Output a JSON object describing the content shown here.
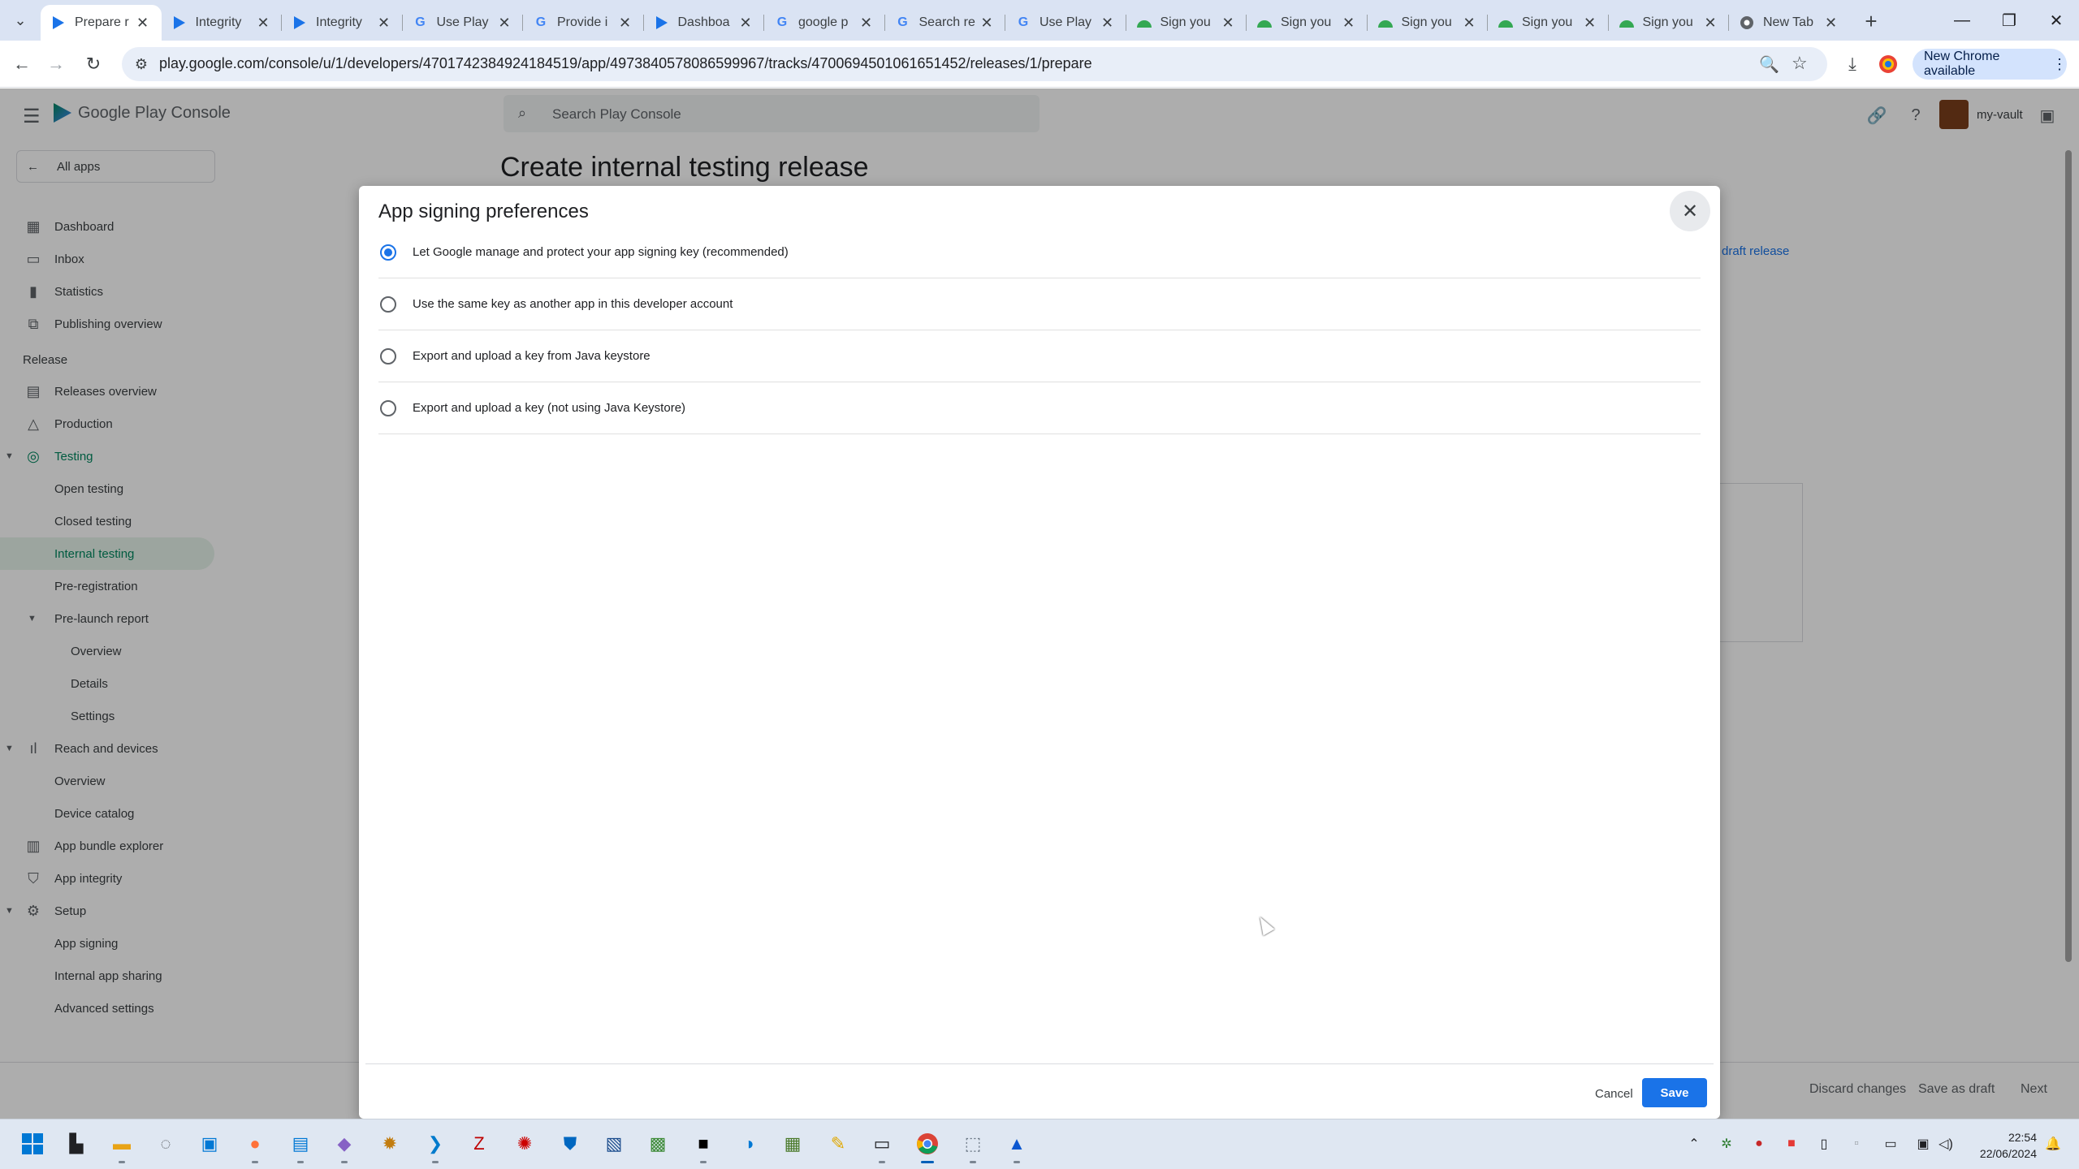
{
  "browser": {
    "tabs": [
      {
        "title": "Prepare r",
        "icon": "play-console-icon",
        "active": true
      },
      {
        "title": "Integrity",
        "icon": "play-console-icon"
      },
      {
        "title": "Integrity",
        "icon": "play-console-icon"
      },
      {
        "title": "Use Play",
        "icon": "google-icon"
      },
      {
        "title": "Provide i",
        "icon": "google-icon"
      },
      {
        "title": "Dashboa",
        "icon": "play-console-icon"
      },
      {
        "title": "google p",
        "icon": "google-icon"
      },
      {
        "title": "Search re",
        "icon": "google-icon"
      },
      {
        "title": "Use Play",
        "icon": "google-icon"
      },
      {
        "title": "Sign you",
        "icon": "android-icon"
      },
      {
        "title": "Sign you",
        "icon": "android-icon"
      },
      {
        "title": "Sign you",
        "icon": "android-icon"
      },
      {
        "title": "Sign you",
        "icon": "android-icon"
      },
      {
        "title": "Sign you",
        "icon": "android-icon"
      },
      {
        "title": "New Tab",
        "icon": "chrome-icon"
      }
    ],
    "url": "play.google.com/console/u/1/developers/4701742384924184519/app/4973840578086599967/tracks/4700694501061651452/releases/1/prepare",
    "update_label": "New Chrome available"
  },
  "console": {
    "product_name": "Google Play Console",
    "search_placeholder": "Search Play Console",
    "account_name": "my-vault",
    "all_apps_label": "All apps",
    "page_title": "Create internal testing release",
    "draft_link": "draft release",
    "footer": {
      "discard": "Discard changes",
      "save_draft": "Save as draft",
      "next": "Next"
    },
    "nav": {
      "dashboard": "Dashboard",
      "inbox": "Inbox",
      "statistics": "Statistics",
      "publishing_overview": "Publishing overview",
      "release_header": "Release",
      "releases_overview": "Releases overview",
      "production": "Production",
      "testing": "Testing",
      "open_testing": "Open testing",
      "closed_testing": "Closed testing",
      "internal_testing": "Internal testing",
      "pre_registration": "Pre-registration",
      "pre_launch_report": "Pre-launch report",
      "overview": "Overview",
      "details": "Details",
      "settings": "Settings",
      "reach_and_devices": "Reach and devices",
      "reach_overview": "Overview",
      "device_catalog": "Device catalog",
      "app_bundle_explorer": "App bundle explorer",
      "app_integrity": "App integrity",
      "setup": "Setup",
      "app_signing": "App signing",
      "internal_app_sharing": "Internal app sharing",
      "advanced_settings": "Advanced settings"
    }
  },
  "dialog": {
    "title": "App signing preferences",
    "options": [
      {
        "label": "Let Google manage and protect your app signing key (recommended)",
        "selected": true
      },
      {
        "label": "Use the same key as another app in this developer account",
        "selected": false
      },
      {
        "label": "Export and upload a key from Java keystore",
        "selected": false
      },
      {
        "label": "Export and upload a key (not using Java Keystore)",
        "selected": false
      }
    ],
    "cancel_label": "Cancel",
    "save_label": "Save"
  },
  "taskbar": {
    "time": "22:54",
    "date": "22/06/2024"
  },
  "colors": {
    "accent": "#1a73e8",
    "play_green": "#01875f",
    "tabstrip": "#dae3f3"
  }
}
